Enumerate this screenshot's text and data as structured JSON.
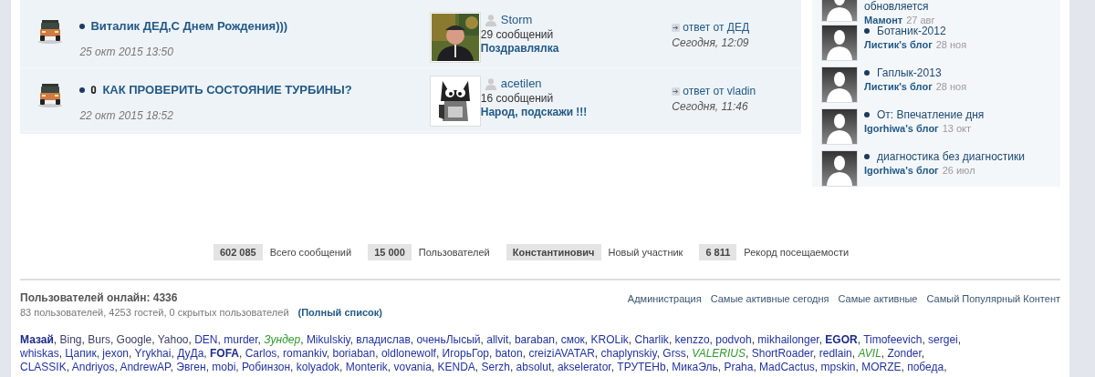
{
  "topics": [
    {
      "title": "Виталик ДЕД,С Днем Рождения)))",
      "pinned": false,
      "date": "25 окт 2015 13:50",
      "last_poster": {
        "name": "Storm",
        "posts": "29 сообщений",
        "post_title": "Поздравлялка"
      },
      "last_reply": {
        "label": "ответ от ДЕД",
        "time": "Сегодня, 12:09"
      }
    },
    {
      "title": "КАК ПРОВЕРИТЬ СОСТОЯНИЕ ТУРБИНЫ?",
      "pinned": true,
      "date": "22 окт 2015 18:52",
      "last_poster": {
        "name": "acetilen",
        "posts": "16 сообщений",
        "post_title": "Народ, подскажи !!!"
      },
      "last_reply": {
        "label": "ответ от vladin",
        "time": "Сегодня, 11:46"
      }
    }
  ],
  "blog_entries": [
    {
      "title": "обновляется",
      "blog": "Мамонт",
      "date": "27 авг",
      "bullet": false
    },
    {
      "title": "Ботаник-2012",
      "blog": "Листик's блог",
      "date": "28 ноя",
      "bullet": true
    },
    {
      "title": "Гаплык-2013",
      "blog": "Листик's блог",
      "date": "28 ноя",
      "bullet": true
    },
    {
      "title": "От: Впечатление дня",
      "blog": "Igorhiwa's блог",
      "date": "13 окт",
      "bullet": true
    },
    {
      "title": "диагностика без диагностики",
      "blog": "Igorhiwa's блог",
      "date": "26 июл",
      "bullet": true
    }
  ],
  "stats": [
    {
      "value": "602 085",
      "label": "Всего сообщений"
    },
    {
      "value": "15 000",
      "label": "Пользователей"
    },
    {
      "value": "Константинович",
      "label": "Новый участник"
    },
    {
      "value": "6 811",
      "label": "Рекорд посещаемости"
    }
  ],
  "online": {
    "title": "Пользователей онлайн: 4336",
    "summary": "83 пользователей, 4253 гостей, 0 скрытых пользователей",
    "full_list_link": "(Полный список)",
    "links": [
      "Администрация",
      "Самые активные сегодня",
      "Самые активные",
      "Самый Популярный Контент"
    ],
    "separator": ",",
    "lines": [
      [
        {
          "name": "Мазай",
          "kind": "admin"
        },
        {
          "name": "Bing",
          "kind": "bot"
        },
        {
          "name": "Burs",
          "kind": "bot"
        },
        {
          "name": "Google",
          "kind": "bot"
        },
        {
          "name": "Yahoo",
          "kind": "bot"
        },
        {
          "name": "DEN",
          "kind": "member"
        },
        {
          "name": "murder",
          "kind": "member"
        },
        {
          "name": "Зундер",
          "kind": "moderator"
        },
        {
          "name": "Mikulskiy",
          "kind": "member"
        },
        {
          "name": "владислав",
          "kind": "member"
        },
        {
          "name": "оченьЛысый",
          "kind": "member"
        },
        {
          "name": "allvit",
          "kind": "member"
        },
        {
          "name": "baraban",
          "kind": "member"
        },
        {
          "name": "смок",
          "kind": "member"
        },
        {
          "name": "KROLik",
          "kind": "member"
        },
        {
          "name": "Charlik",
          "kind": "member"
        },
        {
          "name": "kenzzo",
          "kind": "member"
        },
        {
          "name": "podvoh",
          "kind": "member"
        },
        {
          "name": "mikhailonger",
          "kind": "member"
        },
        {
          "name": "EGOR",
          "kind": "admin"
        },
        {
          "name": "Timofeevich",
          "kind": "member"
        },
        {
          "name": "sergei",
          "kind": "member"
        }
      ],
      [
        {
          "name": "whiskas",
          "kind": "member"
        },
        {
          "name": "Цапик",
          "kind": "member"
        },
        {
          "name": "jexon",
          "kind": "member"
        },
        {
          "name": "Yrykhai",
          "kind": "member"
        },
        {
          "name": "ДуДа",
          "kind": "member"
        },
        {
          "name": "FOFA",
          "kind": "admin"
        },
        {
          "name": "Carlos",
          "kind": "member"
        },
        {
          "name": "romankiv",
          "kind": "member"
        },
        {
          "name": "boriaban",
          "kind": "member"
        },
        {
          "name": "oldlonewolf",
          "kind": "member"
        },
        {
          "name": "ИгорьГор",
          "kind": "member"
        },
        {
          "name": "baton",
          "kind": "member"
        },
        {
          "name": "creiziAVATAR",
          "kind": "member"
        },
        {
          "name": "chaplynskiy",
          "kind": "member"
        },
        {
          "name": "Grss",
          "kind": "member"
        },
        {
          "name": "VALERIUS",
          "kind": "moderator"
        },
        {
          "name": "ShortRoader",
          "kind": "member"
        },
        {
          "name": "redlain",
          "kind": "member"
        },
        {
          "name": "AVIL",
          "kind": "moderator"
        },
        {
          "name": "Zonder",
          "kind": "member"
        }
      ],
      [
        {
          "name": "CLASSIK",
          "kind": "member"
        },
        {
          "name": "Andriyos",
          "kind": "member"
        },
        {
          "name": "AndrewAP",
          "kind": "member"
        },
        {
          "name": "Эвген",
          "kind": "member"
        },
        {
          "name": "mobi",
          "kind": "member"
        },
        {
          "name": "Робинзон",
          "kind": "member"
        },
        {
          "name": "kolyadok",
          "kind": "member"
        },
        {
          "name": "Monterik",
          "kind": "member"
        },
        {
          "name": "vovania",
          "kind": "member"
        },
        {
          "name": "KENDA",
          "kind": "member"
        },
        {
          "name": "Serzh",
          "kind": "member"
        },
        {
          "name": "absolut",
          "kind": "member"
        },
        {
          "name": "akselerator",
          "kind": "member"
        },
        {
          "name": "ТРУТЕНb",
          "kind": "member"
        },
        {
          "name": "МикаЭль",
          "kind": "member"
        },
        {
          "name": "Praha",
          "kind": "member"
        },
        {
          "name": "MadCactus",
          "kind": "member"
        },
        {
          "name": "mpskin",
          "kind": "member"
        },
        {
          "name": "MORZE",
          "kind": "member"
        },
        {
          "name": "победа",
          "kind": "member"
        }
      ]
    ]
  }
}
